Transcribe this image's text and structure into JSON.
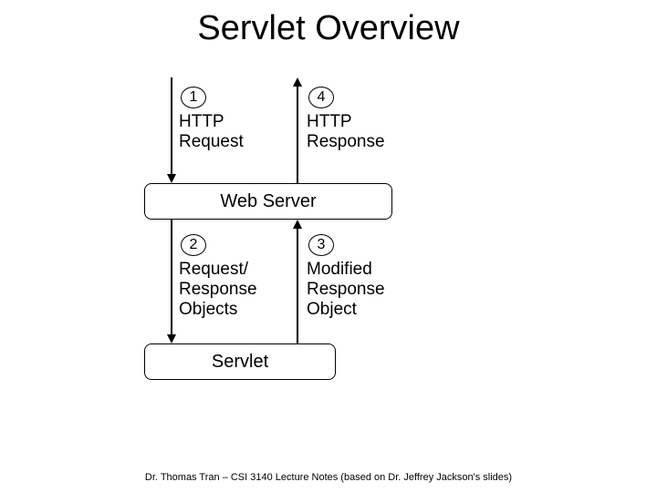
{
  "title": "Servlet Overview",
  "footer": "Dr. Thomas Tran – CSI 3140 Lecture Notes (based on Dr. Jeffrey Jackson's slides)",
  "boxes": {
    "web_server": "Web Server",
    "servlet": "Servlet"
  },
  "steps": {
    "s1": {
      "num": "1",
      "label": "HTTP\nRequest"
    },
    "s2": {
      "num": "2",
      "label": "Request/\nResponse\nObjects"
    },
    "s3": {
      "num": "3",
      "label": "Modified\nResponse\nObject"
    },
    "s4": {
      "num": "4",
      "label": "HTTP\nResponse"
    }
  }
}
